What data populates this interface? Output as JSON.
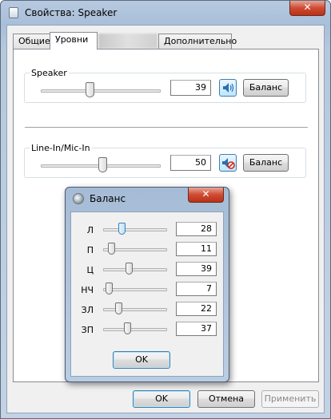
{
  "window": {
    "title": "Свойства: Speaker",
    "close_glyph": "✕"
  },
  "tabs": [
    {
      "label": "Общие"
    },
    {
      "label": "Уровни",
      "active": true
    },
    {
      "label": ""
    },
    {
      "label": "Дополнительно"
    }
  ],
  "levels": {
    "speaker": {
      "label": "Speaker",
      "value": "39",
      "level": 0.39,
      "icon": "speaker-icon",
      "balance_label": "Баланс"
    },
    "line_in": {
      "label": "Line-In/Mic-In",
      "value": "50",
      "level": 0.5,
      "icon": "muted-speaker-icon",
      "balance_label": "Баланс"
    }
  },
  "balance_dialog": {
    "title": "Баланс",
    "close_glyph": "✕",
    "channels": [
      {
        "label": "Л",
        "value": "28",
        "level": 0.28
      },
      {
        "label": "П",
        "value": "11",
        "level": 0.11
      },
      {
        "label": "Ц",
        "value": "39",
        "level": 0.39
      },
      {
        "label": "НЧ",
        "value": "7",
        "level": 0.07
      },
      {
        "label": "ЗЛ",
        "value": "22",
        "level": 0.22
      },
      {
        "label": "ЗП",
        "value": "37",
        "level": 0.37
      }
    ],
    "ok_label": "OK"
  },
  "footer": {
    "ok_label": "OK",
    "cancel_label": "Отмена",
    "apply_label": "Применить"
  }
}
